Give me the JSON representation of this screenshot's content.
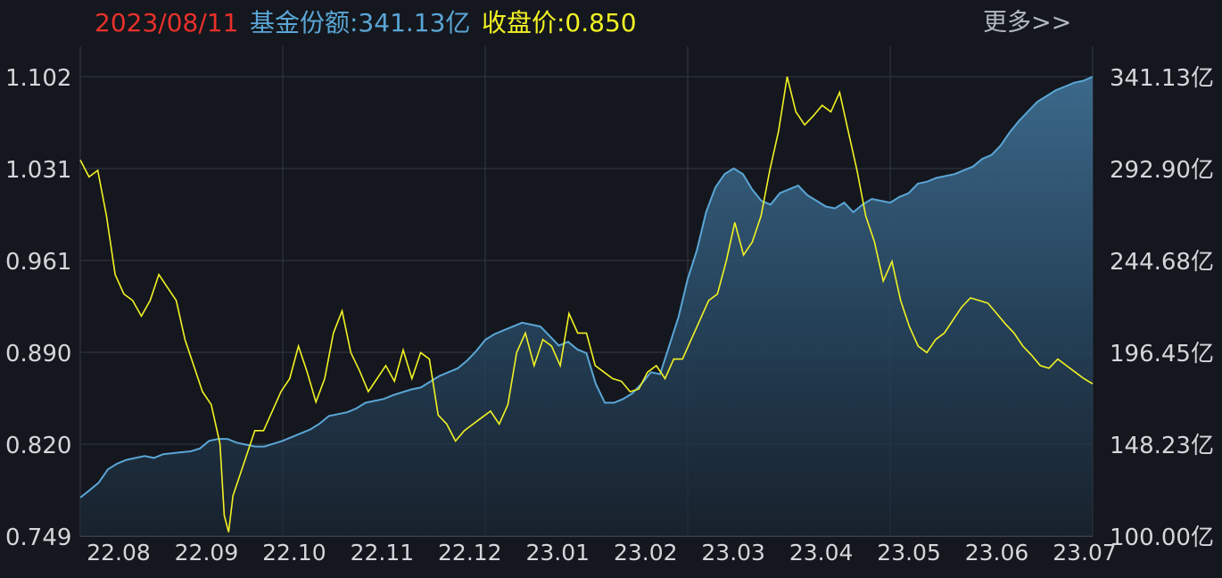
{
  "header": {
    "date": "2023/08/11",
    "share_label": "基金份额:341.13亿",
    "close_label": "收盘价:0.850",
    "more_label": "更多>>"
  },
  "colors": {
    "background": "#14171d",
    "grid": "#2a2f38",
    "date": "#e8312a",
    "share": "#5aa6d6",
    "close": "#f2f224",
    "axis_text": "#d3d6db"
  },
  "chart_data": {
    "type": "line",
    "title": "",
    "xlabel": "",
    "ylabel": "",
    "left_axis": {
      "series": "close_price",
      "ylim": [
        0.749,
        1.102
      ],
      "ticks": [
        "1.102",
        "1.031",
        "0.961",
        "0.890",
        "0.820",
        "0.749"
      ]
    },
    "right_axis": {
      "series": "fund_share",
      "ylim": [
        100.0,
        341.13
      ],
      "ticks": [
        "341.13亿",
        "292.90亿",
        "244.68亿",
        "196.45亿",
        "148.23亿",
        "100.00亿"
      ]
    },
    "x_ticks": [
      "22.08",
      "22.09",
      "22.10",
      "22.11",
      "22.12",
      "23.01",
      "23.02",
      "23.03",
      "23.04",
      "23.05",
      "23.06",
      "23.07"
    ],
    "x_range": [
      "22.08",
      "23.08.11"
    ],
    "grid": true,
    "series": [
      {
        "key": "fund_share",
        "axis": "right",
        "style": "area",
        "points": [
          [
            0.0,
            120.2
          ],
          [
            0.2,
            124.0
          ],
          [
            0.4,
            128.0
          ],
          [
            0.6,
            135.0
          ],
          [
            0.8,
            138.0
          ],
          [
            1.0,
            140.0
          ],
          [
            1.2,
            141.0
          ],
          [
            1.4,
            142.0
          ],
          [
            1.6,
            141.0
          ],
          [
            1.8,
            143.0
          ],
          [
            2.0,
            143.5
          ],
          [
            2.2,
            144.0
          ],
          [
            2.4,
            144.5
          ],
          [
            2.6,
            146.0
          ],
          [
            2.8,
            150.0
          ],
          [
            3.0,
            151.0
          ],
          [
            3.2,
            151.0
          ],
          [
            3.4,
            149.0
          ],
          [
            3.6,
            148.0
          ],
          [
            3.8,
            147.0
          ],
          [
            4.0,
            147.0
          ],
          [
            4.2,
            148.5
          ],
          [
            4.4,
            150.0
          ],
          [
            4.6,
            152.0
          ],
          [
            4.8,
            154.0
          ],
          [
            5.0,
            156.0
          ],
          [
            5.2,
            159.0
          ],
          [
            5.4,
            163.0
          ],
          [
            5.6,
            164.0
          ],
          [
            5.8,
            165.0
          ],
          [
            6.0,
            167.0
          ],
          [
            6.2,
            170.0
          ],
          [
            6.4,
            171.0
          ],
          [
            6.6,
            172.0
          ],
          [
            6.8,
            174.0
          ],
          [
            7.0,
            175.5
          ],
          [
            7.2,
            177.0
          ],
          [
            7.4,
            178.0
          ],
          [
            7.6,
            181.0
          ],
          [
            7.8,
            184.0
          ],
          [
            8.0,
            186.0
          ],
          [
            8.2,
            188.0
          ],
          [
            8.4,
            192.0
          ],
          [
            8.6,
            197.0
          ],
          [
            8.8,
            203.0
          ],
          [
            9.0,
            206.0
          ],
          [
            9.2,
            208.0
          ],
          [
            9.4,
            210.0
          ],
          [
            9.6,
            212.0
          ],
          [
            9.8,
            211.0
          ],
          [
            10.0,
            210.0
          ],
          [
            10.2,
            205.0
          ],
          [
            10.4,
            200.0
          ],
          [
            10.6,
            202.0
          ],
          [
            10.8,
            198.0
          ],
          [
            11.0,
            196.0
          ],
          [
            11.2,
            180.0
          ],
          [
            11.4,
            170.0
          ],
          [
            11.6,
            170.0
          ],
          [
            11.8,
            172.0
          ],
          [
            12.0,
            175.0
          ],
          [
            12.2,
            180.0
          ],
          [
            12.4,
            186.0
          ],
          [
            12.6,
            185.0
          ],
          [
            12.8,
            200.0
          ],
          [
            13.0,
            215.0
          ],
          [
            13.2,
            235.0
          ],
          [
            13.4,
            250.0
          ],
          [
            13.6,
            270.0
          ],
          [
            13.8,
            283.0
          ],
          [
            14.0,
            290.0
          ],
          [
            14.2,
            293.0
          ],
          [
            14.4,
            290.0
          ],
          [
            14.6,
            282.0
          ],
          [
            14.8,
            276.0
          ],
          [
            15.0,
            274.0
          ],
          [
            15.2,
            280.0
          ],
          [
            15.4,
            282.0
          ],
          [
            15.6,
            284.0
          ],
          [
            15.8,
            279.0
          ],
          [
            16.0,
            276.0
          ],
          [
            16.2,
            273.0
          ],
          [
            16.4,
            272.0
          ],
          [
            16.6,
            275.0
          ],
          [
            16.8,
            270.0
          ],
          [
            17.0,
            274.0
          ],
          [
            17.2,
            277.0
          ],
          [
            17.4,
            276.0
          ],
          [
            17.6,
            275.0
          ],
          [
            17.8,
            278.0
          ],
          [
            18.0,
            280.0
          ],
          [
            18.2,
            285.0
          ],
          [
            18.4,
            286.0
          ],
          [
            18.6,
            288.0
          ],
          [
            18.8,
            289.0
          ],
          [
            19.0,
            290.0
          ],
          [
            19.2,
            292.0
          ],
          [
            19.4,
            294.0
          ],
          [
            19.6,
            298.0
          ],
          [
            19.8,
            300.0
          ],
          [
            20.0,
            305.0
          ],
          [
            20.2,
            312.0
          ],
          [
            20.4,
            318.0
          ],
          [
            20.6,
            323.0
          ],
          [
            20.8,
            328.0
          ],
          [
            21.0,
            331.0
          ],
          [
            21.2,
            334.0
          ],
          [
            21.4,
            336.0
          ],
          [
            21.6,
            338.0
          ],
          [
            21.8,
            339.0
          ],
          [
            22.0,
            341.13
          ]
        ]
      },
      {
        "key": "close_price",
        "axis": "left",
        "style": "line",
        "points": [
          [
            0.0,
            1.038
          ],
          [
            0.2,
            1.025
          ],
          [
            0.4,
            1.03
          ],
          [
            0.6,
            0.995
          ],
          [
            0.8,
            0.95
          ],
          [
            1.0,
            0.935
          ],
          [
            1.2,
            0.93
          ],
          [
            1.4,
            0.918
          ],
          [
            1.6,
            0.93
          ],
          [
            1.8,
            0.95
          ],
          [
            2.0,
            0.94
          ],
          [
            2.2,
            0.93
          ],
          [
            2.4,
            0.9
          ],
          [
            2.6,
            0.88
          ],
          [
            2.8,
            0.86
          ],
          [
            3.0,
            0.85
          ],
          [
            3.2,
            0.82
          ],
          [
            3.3,
            0.765
          ],
          [
            3.4,
            0.752
          ],
          [
            3.5,
            0.78
          ],
          [
            3.6,
            0.79
          ],
          [
            3.8,
            0.81
          ],
          [
            4.0,
            0.83
          ],
          [
            4.2,
            0.83
          ],
          [
            4.4,
            0.845
          ],
          [
            4.6,
            0.86
          ],
          [
            4.8,
            0.87
          ],
          [
            5.0,
            0.895
          ],
          [
            5.2,
            0.875
          ],
          [
            5.4,
            0.852
          ],
          [
            5.6,
            0.87
          ],
          [
            5.8,
            0.905
          ],
          [
            6.0,
            0.922
          ],
          [
            6.2,
            0.89
          ],
          [
            6.4,
            0.876
          ],
          [
            6.6,
            0.86
          ],
          [
            6.8,
            0.87
          ],
          [
            7.0,
            0.88
          ],
          [
            7.2,
            0.868
          ],
          [
            7.4,
            0.892
          ],
          [
            7.6,
            0.87
          ],
          [
            7.8,
            0.89
          ],
          [
            8.0,
            0.885
          ],
          [
            8.2,
            0.842
          ],
          [
            8.4,
            0.835
          ],
          [
            8.6,
            0.822
          ],
          [
            8.8,
            0.83
          ],
          [
            9.0,
            0.835
          ],
          [
            9.2,
            0.84
          ],
          [
            9.4,
            0.845
          ],
          [
            9.6,
            0.835
          ],
          [
            9.8,
            0.85
          ],
          [
            10.0,
            0.89
          ],
          [
            10.2,
            0.905
          ],
          [
            10.4,
            0.88
          ],
          [
            10.6,
            0.9
          ],
          [
            10.8,
            0.895
          ],
          [
            11.0,
            0.88
          ],
          [
            11.2,
            0.92
          ],
          [
            11.4,
            0.905
          ],
          [
            11.6,
            0.905
          ],
          [
            11.8,
            0.88
          ],
          [
            12.0,
            0.875
          ],
          [
            12.2,
            0.87
          ],
          [
            12.4,
            0.868
          ],
          [
            12.6,
            0.86
          ],
          [
            12.8,
            0.862
          ],
          [
            13.0,
            0.875
          ],
          [
            13.2,
            0.88
          ],
          [
            13.4,
            0.87
          ],
          [
            13.6,
            0.885
          ],
          [
            13.8,
            0.885
          ],
          [
            14.0,
            0.9
          ],
          [
            14.2,
            0.915
          ],
          [
            14.4,
            0.93
          ],
          [
            14.6,
            0.935
          ],
          [
            14.8,
            0.96
          ],
          [
            15.0,
            0.99
          ],
          [
            15.2,
            0.965
          ],
          [
            15.4,
            0.975
          ],
          [
            15.6,
            0.995
          ],
          [
            15.8,
            1.03
          ],
          [
            16.0,
            1.06
          ],
          [
            16.2,
            1.102
          ],
          [
            16.4,
            1.075
          ],
          [
            16.6,
            1.065
          ],
          [
            16.8,
            1.072
          ],
          [
            17.0,
            1.08
          ],
          [
            17.2,
            1.075
          ],
          [
            17.4,
            1.09
          ],
          [
            17.6,
            1.06
          ],
          [
            17.8,
            1.03
          ],
          [
            18.0,
            0.995
          ],
          [
            18.2,
            0.975
          ],
          [
            18.4,
            0.945
          ],
          [
            18.6,
            0.96
          ],
          [
            18.8,
            0.93
          ],
          [
            19.0,
            0.91
          ],
          [
            19.2,
            0.895
          ],
          [
            19.4,
            0.89
          ],
          [
            19.6,
            0.9
          ],
          [
            19.8,
            0.905
          ],
          [
            20.0,
            0.915
          ],
          [
            20.2,
            0.925
          ],
          [
            20.4,
            0.932
          ],
          [
            20.6,
            0.93
          ],
          [
            20.8,
            0.928
          ],
          [
            21.0,
            0.92
          ],
          [
            21.2,
            0.912
          ],
          [
            21.4,
            0.905
          ],
          [
            21.6,
            0.895
          ],
          [
            21.8,
            0.888
          ],
          [
            22.0,
            0.88
          ],
          [
            22.2,
            0.878
          ],
          [
            22.4,
            0.885
          ],
          [
            22.6,
            0.88
          ],
          [
            22.8,
            0.875
          ],
          [
            23.0,
            0.87
          ],
          [
            23.2,
            0.866
          ]
        ]
      }
    ]
  }
}
